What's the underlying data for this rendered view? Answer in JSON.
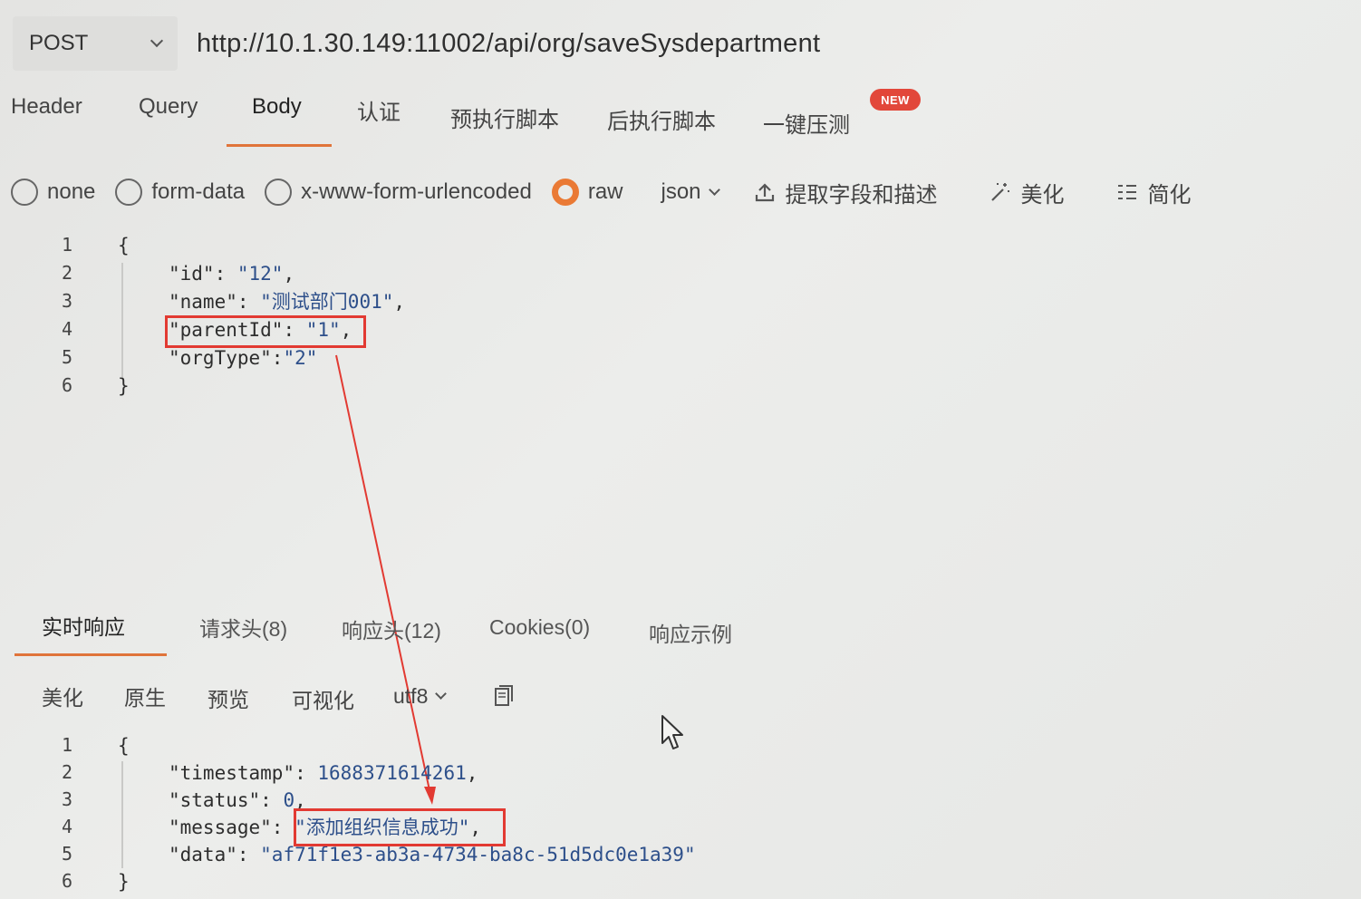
{
  "request": {
    "method": "POST",
    "url": "http://10.1.30.149:11002/api/org/saveSysdepartment"
  },
  "request_tabs": [
    {
      "label": "Header"
    },
    {
      "label": "Query"
    },
    {
      "label": "Body"
    },
    {
      "label": "认证"
    },
    {
      "label": "预执行脚本"
    },
    {
      "label": "后执行脚本"
    },
    {
      "label": "一键压测"
    }
  ],
  "new_badge": "NEW",
  "body_types": [
    {
      "label": "none"
    },
    {
      "label": "form-data"
    },
    {
      "label": "x-www-form-urlencoded"
    },
    {
      "label": "raw"
    }
  ],
  "selected_body_type": "raw",
  "format": "json",
  "body_tools": {
    "extract": "提取字段和描述",
    "beautify": "美化",
    "simplify": "简化"
  },
  "request_body": {
    "line_numbers": [
      "1",
      "2",
      "3",
      "4",
      "5",
      "6"
    ],
    "open": "{",
    "id_key": "\"id\"",
    "id_sep": ": ",
    "id_val": "\"12\"",
    "id_end": ",",
    "name_key": "\"name\"",
    "name_sep": ": ",
    "name_val": "\"测试部门001\"",
    "name_end": ",",
    "parent_key": "\"parentId\"",
    "parent_sep": ": ",
    "parent_val": "\"1\"",
    "parent_end": ",",
    "org_key": "\"orgType\"",
    "org_sep": ":",
    "org_val": "\"2\"",
    "close": "}"
  },
  "response_tabs": [
    {
      "label": "实时响应"
    },
    {
      "label": "请求头(8)"
    },
    {
      "label": "响应头(12)"
    },
    {
      "label": "Cookies(0)"
    },
    {
      "label": "响应示例"
    }
  ],
  "response_tools": {
    "beautify": "美化",
    "raw": "原生",
    "preview": "预览",
    "visualize": "可视化",
    "encoding": "utf8"
  },
  "response_body": {
    "line_numbers": [
      "1",
      "2",
      "3",
      "4",
      "5",
      "6"
    ],
    "open": "{",
    "ts_key": "\"timestamp\"",
    "ts_sep": ": ",
    "ts_val": "1688371614261",
    "ts_end": ",",
    "status_key": "\"status\"",
    "status_sep": ": ",
    "status_val": "0",
    "status_end": ",",
    "msg_key": "\"message\"",
    "msg_sep": ": ",
    "msg_val": "\"添加组织信息成功\"",
    "msg_end": ",",
    "data_key": "\"data\"",
    "data_sep": ": ",
    "data_val": "\"af71f1e3-ab3a-4734-ba8c-51d5dc0e1a39\"",
    "close": "}"
  },
  "colors": {
    "accent": "#ea7a35",
    "annotation": "#e23a32",
    "string": "#2d4f8a"
  }
}
